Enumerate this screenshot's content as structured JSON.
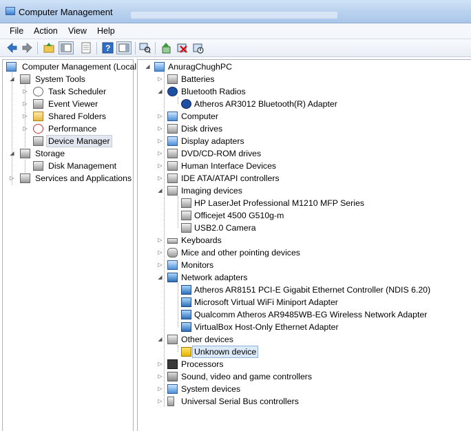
{
  "window": {
    "title": "Computer Management"
  },
  "menu": [
    "File",
    "Action",
    "View",
    "Help"
  ],
  "toolbar_icons": [
    "back-arrow-icon",
    "forward-arrow-icon",
    "up-folder-icon",
    "show-hide-tree-icon",
    "properties-icon",
    "help-icon",
    "show-hide-action-pane-icon",
    "scan-hardware-icon",
    "update-driver-icon",
    "uninstall-icon",
    "disable-device-icon"
  ],
  "left_tree": [
    {
      "label": "Computer Management (Local",
      "icon": "computer-management-icon"
    },
    {
      "label": "System Tools",
      "icon": "tools-icon"
    },
    {
      "label": "Task Scheduler",
      "icon": "clock-icon"
    },
    {
      "label": "Event Viewer",
      "icon": "event-viewer-icon"
    },
    {
      "label": "Shared Folders",
      "icon": "shared-folder-icon"
    },
    {
      "label": "Performance",
      "icon": "performance-icon"
    },
    {
      "label": "Device Manager",
      "icon": "device-manager-icon"
    },
    {
      "label": "Storage",
      "icon": "storage-icon"
    },
    {
      "label": "Disk Management",
      "icon": "disk-management-icon"
    },
    {
      "label": "Services and Applications",
      "icon": "services-icon"
    }
  ],
  "device_tree": {
    "root": "AnuragChughPC",
    "items": [
      {
        "label": "Batteries"
      },
      {
        "label": "Bluetooth Radios"
      },
      {
        "label": "Atheros AR3012 Bluetooth(R) Adapter"
      },
      {
        "label": "Computer"
      },
      {
        "label": "Disk drives"
      },
      {
        "label": "Display adapters"
      },
      {
        "label": "DVD/CD-ROM drives"
      },
      {
        "label": "Human Interface Devices"
      },
      {
        "label": "IDE ATA/ATAPI controllers"
      },
      {
        "label": "Imaging devices"
      },
      {
        "label": "HP LaserJet Professional M1210 MFP Series"
      },
      {
        "label": "Officejet 4500 G510g-m"
      },
      {
        "label": "USB2.0 Camera"
      },
      {
        "label": "Keyboards"
      },
      {
        "label": "Mice and other pointing devices"
      },
      {
        "label": "Monitors"
      },
      {
        "label": "Network adapters"
      },
      {
        "label": "Atheros AR8151 PCI-E Gigabit Ethernet Controller (NDIS 6.20)"
      },
      {
        "label": "Microsoft Virtual WiFi Miniport Adapter"
      },
      {
        "label": "Qualcomm Atheros AR9485WB-EG Wireless Network Adapter"
      },
      {
        "label": "VirtualBox Host-Only Ethernet Adapter"
      },
      {
        "label": "Other devices"
      },
      {
        "label": "Unknown device"
      },
      {
        "label": "Processors"
      },
      {
        "label": "Sound, video and game controllers"
      },
      {
        "label": "System devices"
      },
      {
        "label": "Universal Serial Bus controllers"
      }
    ]
  }
}
